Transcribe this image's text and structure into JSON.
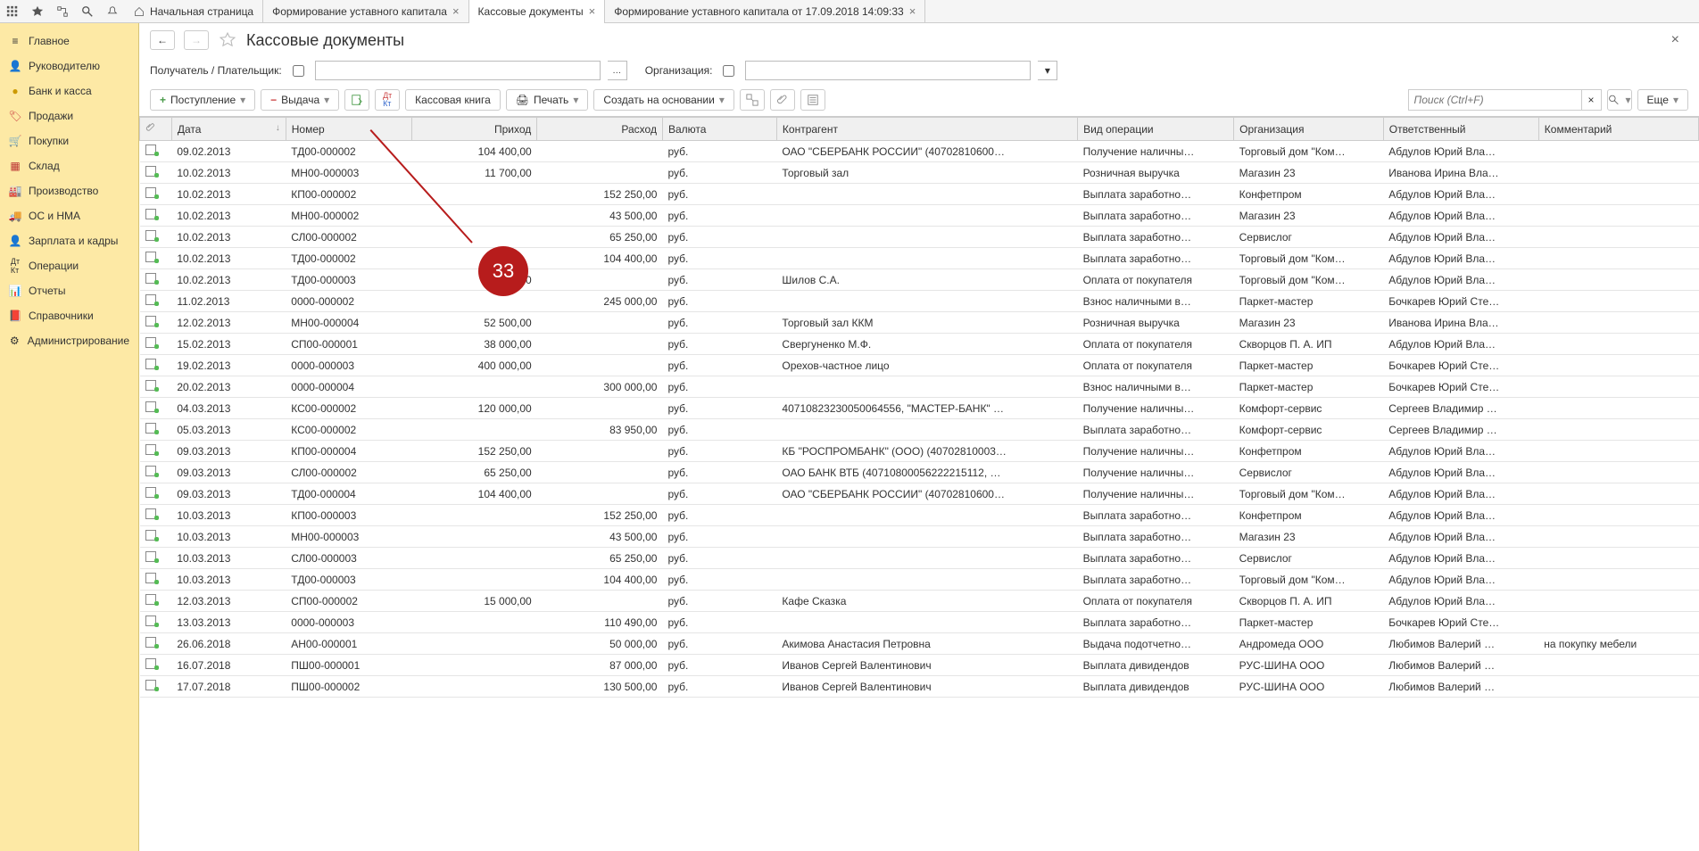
{
  "tabs": {
    "home": "Начальная страница",
    "t1": "Формирование уставного капитала",
    "t2": "Кассовые документы",
    "t3": "Формирование уставного капитала от 17.09.2018 14:09:33"
  },
  "sidebar": [
    {
      "label": "Главное",
      "icon": "star"
    },
    {
      "label": "Руководителю",
      "icon": "person"
    },
    {
      "label": "Банк и касса",
      "icon": "coin"
    },
    {
      "label": "Продажи",
      "icon": "tag"
    },
    {
      "label": "Покупки",
      "icon": "cart"
    },
    {
      "label": "Склад",
      "icon": "boxes"
    },
    {
      "label": "Производство",
      "icon": "factory"
    },
    {
      "label": "ОС и НМА",
      "icon": "truck"
    },
    {
      "label": "Зарплата и кадры",
      "icon": "user"
    },
    {
      "label": "Операции",
      "icon": "dkt"
    },
    {
      "label": "Отчеты",
      "icon": "chart"
    },
    {
      "label": "Справочники",
      "icon": "book"
    },
    {
      "label": "Администрирование",
      "icon": "gear"
    }
  ],
  "page": {
    "title": "Кассовые документы"
  },
  "filters": {
    "recipient_label": "Получатель / Плательщик:",
    "org_label": "Организация:"
  },
  "toolbar": {
    "income": "Поступление",
    "outcome": "Выдача",
    "cashbook": "Кассовая книга",
    "print": "Печать",
    "create_based": "Создать на основании",
    "more": "Еще",
    "search_placeholder": "Поиск (Ctrl+F)"
  },
  "columns": {
    "clip": "",
    "date": "Дата",
    "num": "Номер",
    "in": "Приход",
    "out": "Расход",
    "cur": "Валюта",
    "cp": "Контрагент",
    "op": "Вид операции",
    "org": "Организация",
    "resp": "Ответственный",
    "comm": "Комментарий"
  },
  "marker": {
    "text": "33"
  },
  "rows": [
    {
      "date": "09.02.2013",
      "num": "ТД00-000002",
      "in": "104 400,00",
      "out": "",
      "cur": "руб.",
      "cp": "ОАО \"СБЕРБАНК РОССИИ\" (40702810600…",
      "op": "Получение наличны…",
      "org": "Торговый дом \"Ком…",
      "resp": "Абдулов Юрий Вла…",
      "comm": ""
    },
    {
      "date": "10.02.2013",
      "num": "МН00-000003",
      "in": "11 700,00",
      "out": "",
      "cur": "руб.",
      "cp": "Торговый зал",
      "op": "Розничная выручка",
      "org": "Магазин 23",
      "resp": "Иванова Ирина Вла…",
      "comm": ""
    },
    {
      "date": "10.02.2013",
      "num": "КП00-000002",
      "in": "",
      "out": "152 250,00",
      "cur": "руб.",
      "cp": "",
      "op": "Выплата заработно…",
      "org": "Конфетпром",
      "resp": "Абдулов Юрий Вла…",
      "comm": ""
    },
    {
      "date": "10.02.2013",
      "num": "МН00-000002",
      "in": "",
      "out": "43 500,00",
      "cur": "руб.",
      "cp": "",
      "op": "Выплата заработно…",
      "org": "Магазин 23",
      "resp": "Абдулов Юрий Вла…",
      "comm": ""
    },
    {
      "date": "10.02.2013",
      "num": "СЛ00-000002",
      "in": "",
      "out": "65 250,00",
      "cur": "руб.",
      "cp": "",
      "op": "Выплата заработно…",
      "org": "Сервислог",
      "resp": "Абдулов Юрий Вла…",
      "comm": ""
    },
    {
      "date": "10.02.2013",
      "num": "ТД00-000002",
      "in": "",
      "out": "104 400,00",
      "cur": "руб.",
      "cp": "",
      "op": "Выплата заработно…",
      "org": "Торговый дом \"Ком…",
      "resp": "Абдулов Юрий Вла…",
      "comm": ""
    },
    {
      "date": "10.02.2013",
      "num": "ТД00-000003",
      "in": "73 605,00",
      "out": "",
      "cur": "руб.",
      "cp": "Шилов С.А.",
      "op": "Оплата от покупателя",
      "org": "Торговый дом \"Ком…",
      "resp": "Абдулов Юрий Вла…",
      "comm": ""
    },
    {
      "date": "11.02.2013",
      "num": "0000-000002",
      "in": "",
      "out": "245 000,00",
      "cur": "руб.",
      "cp": "",
      "op": "Взнос наличными в…",
      "org": "Паркет-мастер",
      "resp": "Бочкарев Юрий Сте…",
      "comm": ""
    },
    {
      "date": "12.02.2013",
      "num": "МН00-000004",
      "in": "52 500,00",
      "out": "",
      "cur": "руб.",
      "cp": "Торговый зал ККМ",
      "op": "Розничная выручка",
      "org": "Магазин 23",
      "resp": "Иванова Ирина Вла…",
      "comm": ""
    },
    {
      "date": "15.02.2013",
      "num": "СП00-000001",
      "in": "38 000,00",
      "out": "",
      "cur": "руб.",
      "cp": "Свергуненко М.Ф.",
      "op": "Оплата от покупателя",
      "org": "Скворцов П. А. ИП",
      "resp": "Абдулов Юрий Вла…",
      "comm": ""
    },
    {
      "date": "19.02.2013",
      "num": "0000-000003",
      "in": "400 000,00",
      "out": "",
      "cur": "руб.",
      "cp": "Орехов-частное лицо",
      "op": "Оплата от покупателя",
      "org": "Паркет-мастер",
      "resp": "Бочкарев Юрий Сте…",
      "comm": ""
    },
    {
      "date": "20.02.2013",
      "num": "0000-000004",
      "in": "",
      "out": "300 000,00",
      "cur": "руб.",
      "cp": "",
      "op": "Взнос наличными в…",
      "org": "Паркет-мастер",
      "resp": "Бочкарев Юрий Сте…",
      "comm": ""
    },
    {
      "date": "04.03.2013",
      "num": "КС00-000002",
      "in": "120 000,00",
      "out": "",
      "cur": "руб.",
      "cp": "40710823230050064556, \"МАСТЕР-БАНК\" …",
      "op": "Получение наличны…",
      "org": "Комфорт-сервис",
      "resp": "Сергеев Владимир …",
      "comm": ""
    },
    {
      "date": "05.03.2013",
      "num": "КС00-000002",
      "in": "",
      "out": "83 950,00",
      "cur": "руб.",
      "cp": "",
      "op": "Выплата заработно…",
      "org": "Комфорт-сервис",
      "resp": "Сергеев Владимир …",
      "comm": ""
    },
    {
      "date": "09.03.2013",
      "num": "КП00-000004",
      "in": "152 250,00",
      "out": "",
      "cur": "руб.",
      "cp": "КБ \"РОСПРОМБАНК\" (ООО) (40702810003…",
      "op": "Получение наличны…",
      "org": "Конфетпром",
      "resp": "Абдулов Юрий Вла…",
      "comm": ""
    },
    {
      "date": "09.03.2013",
      "num": "СЛ00-000002",
      "in": "65 250,00",
      "out": "",
      "cur": "руб.",
      "cp": "ОАО БАНК ВТБ (40710800056222215112, …",
      "op": "Получение наличны…",
      "org": "Сервислог",
      "resp": "Абдулов Юрий Вла…",
      "comm": ""
    },
    {
      "date": "09.03.2013",
      "num": "ТД00-000004",
      "in": "104 400,00",
      "out": "",
      "cur": "руб.",
      "cp": "ОАО \"СБЕРБАНК РОССИИ\" (40702810600…",
      "op": "Получение наличны…",
      "org": "Торговый дом \"Ком…",
      "resp": "Абдулов Юрий Вла…",
      "comm": ""
    },
    {
      "date": "10.03.2013",
      "num": "КП00-000003",
      "in": "",
      "out": "152 250,00",
      "cur": "руб.",
      "cp": "",
      "op": "Выплата заработно…",
      "org": "Конфетпром",
      "resp": "Абдулов Юрий Вла…",
      "comm": ""
    },
    {
      "date": "10.03.2013",
      "num": "МН00-000003",
      "in": "",
      "out": "43 500,00",
      "cur": "руб.",
      "cp": "",
      "op": "Выплата заработно…",
      "org": "Магазин 23",
      "resp": "Абдулов Юрий Вла…",
      "comm": ""
    },
    {
      "date": "10.03.2013",
      "num": "СЛ00-000003",
      "in": "",
      "out": "65 250,00",
      "cur": "руб.",
      "cp": "",
      "op": "Выплата заработно…",
      "org": "Сервислог",
      "resp": "Абдулов Юрий Вла…",
      "comm": ""
    },
    {
      "date": "10.03.2013",
      "num": "ТД00-000003",
      "in": "",
      "out": "104 400,00",
      "cur": "руб.",
      "cp": "",
      "op": "Выплата заработно…",
      "org": "Торговый дом \"Ком…",
      "resp": "Абдулов Юрий Вла…",
      "comm": ""
    },
    {
      "date": "12.03.2013",
      "num": "СП00-000002",
      "in": "15 000,00",
      "out": "",
      "cur": "руб.",
      "cp": "Кафе Сказка",
      "op": "Оплата от покупателя",
      "org": "Скворцов П. А. ИП",
      "resp": "Абдулов Юрий Вла…",
      "comm": ""
    },
    {
      "date": "13.03.2013",
      "num": "0000-000003",
      "in": "",
      "out": "110 490,00",
      "cur": "руб.",
      "cp": "",
      "op": "Выплата заработно…",
      "org": "Паркет-мастер",
      "resp": "Бочкарев Юрий Сте…",
      "comm": ""
    },
    {
      "date": "26.06.2018",
      "num": "АН00-000001",
      "in": "",
      "out": "50 000,00",
      "cur": "руб.",
      "cp": "Акимова Анастасия Петровна",
      "op": "Выдача подотчетно…",
      "org": "Андромеда ООО",
      "resp": "Любимов Валерий …",
      "comm": "на покупку мебели"
    },
    {
      "date": "16.07.2018",
      "num": "ПШ00-000001",
      "in": "",
      "out": "87 000,00",
      "cur": "руб.",
      "cp": "Иванов Сергей Валентинович",
      "op": "Выплата дивидендов",
      "org": "РУС-ШИНА ООО",
      "resp": "Любимов Валерий …",
      "comm": ""
    },
    {
      "date": "17.07.2018",
      "num": "ПШ00-000002",
      "in": "",
      "out": "130 500,00",
      "cur": "руб.",
      "cp": "Иванов Сергей Валентинович",
      "op": "Выплата дивидендов",
      "org": "РУС-ШИНА ООО",
      "resp": "Любимов Валерий …",
      "comm": ""
    }
  ]
}
